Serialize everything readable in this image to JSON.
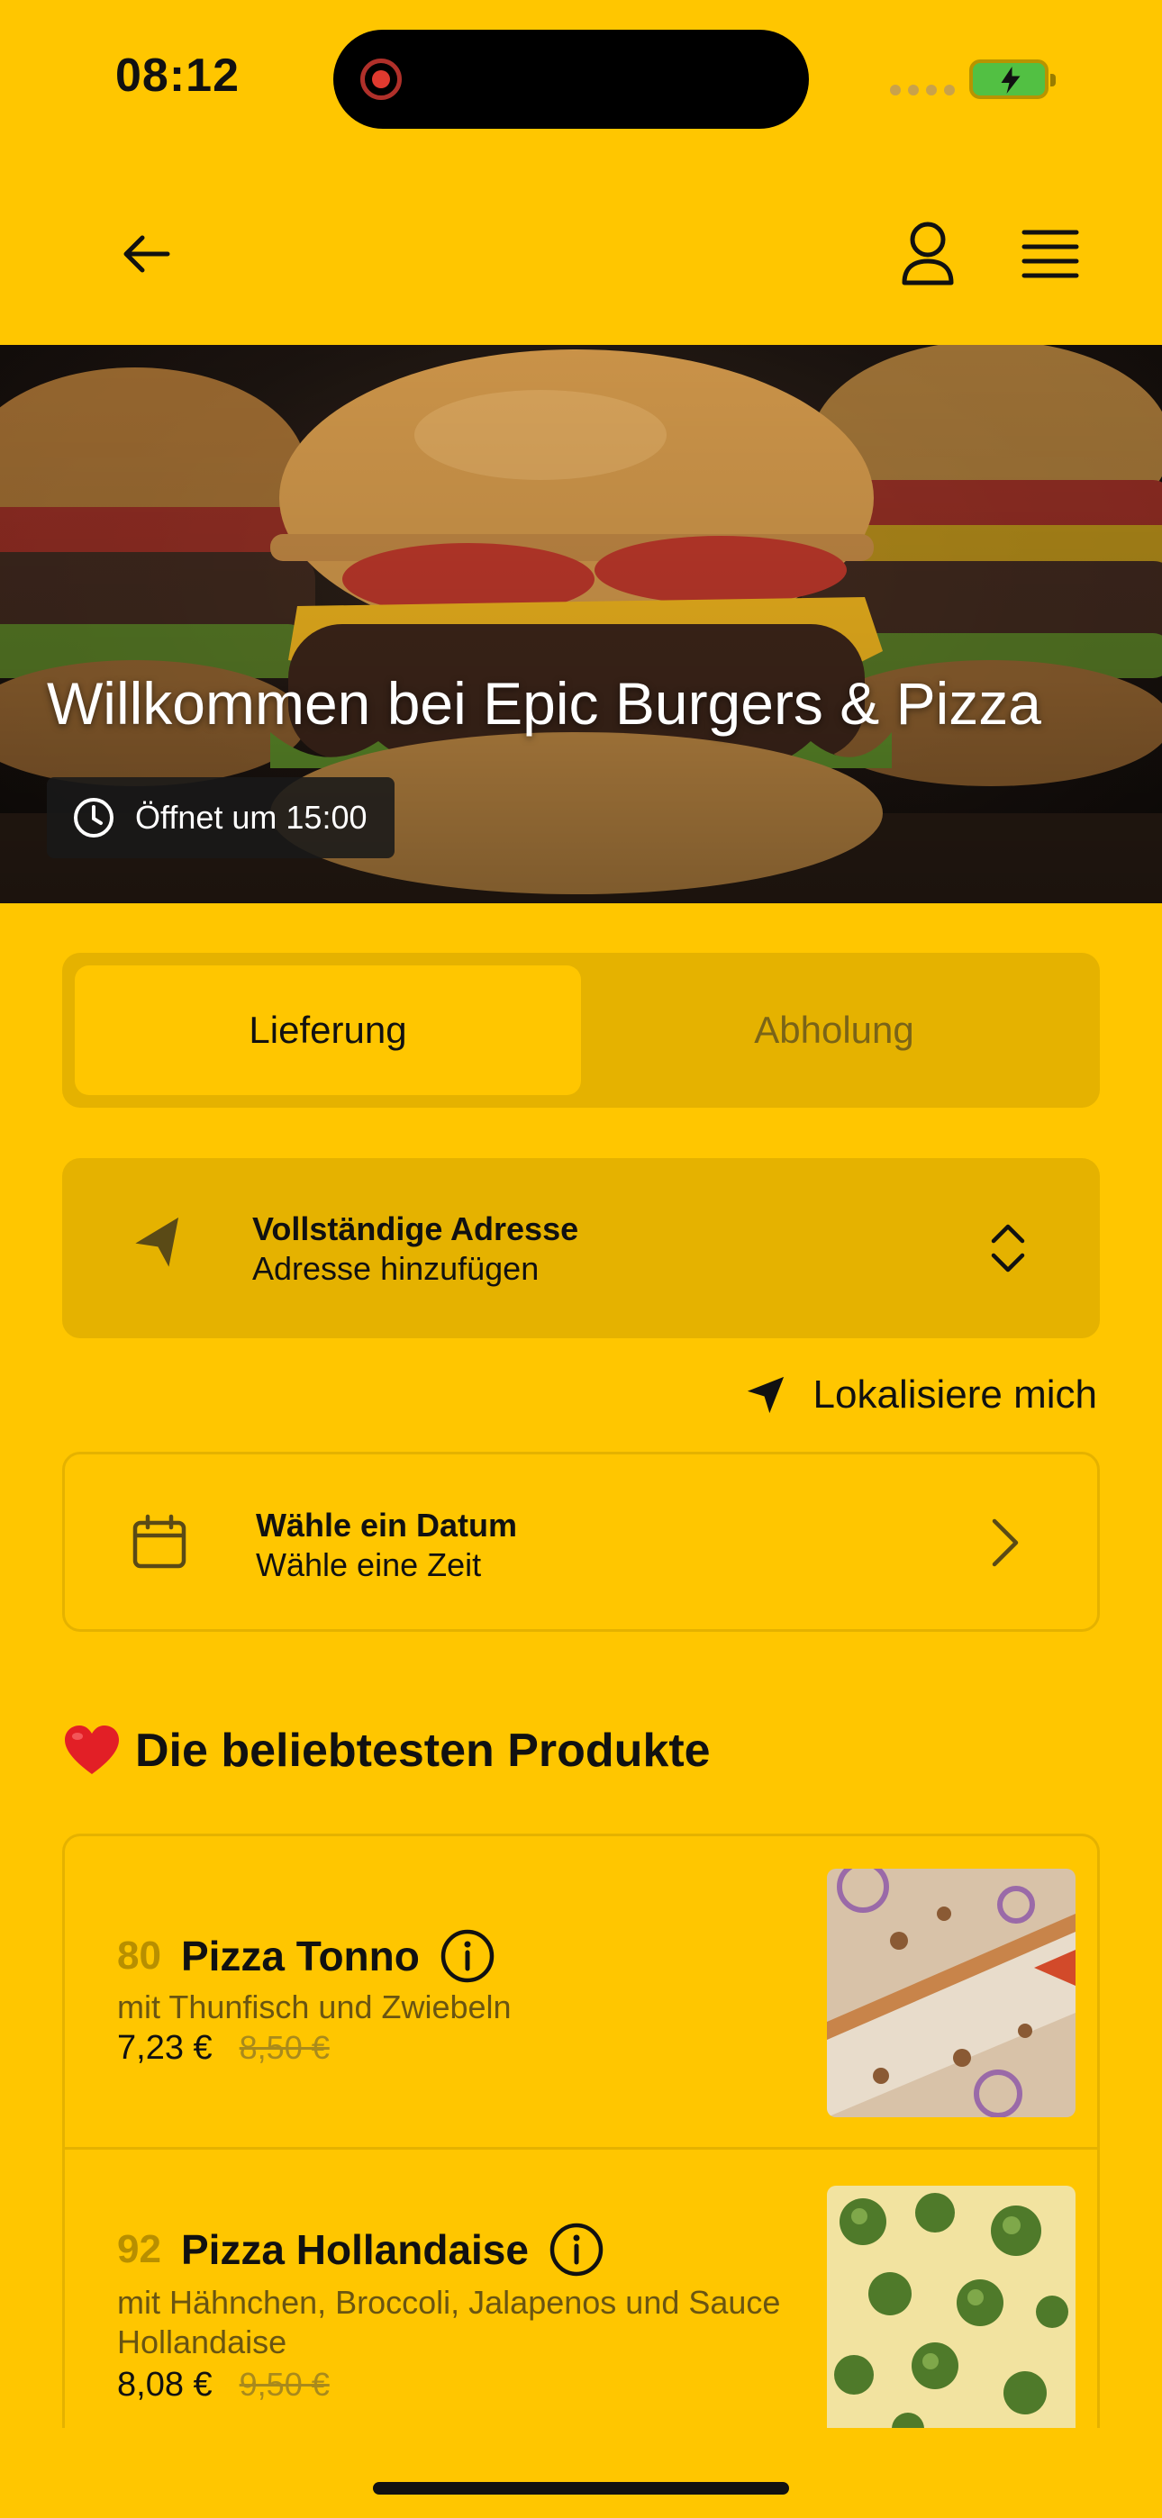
{
  "status_bar": {
    "time": "08:12"
  },
  "hero": {
    "title": "Willkommen bei Epic Burgers & Pizza",
    "opening": "Öffnet um 15:00"
  },
  "tabs": [
    {
      "label": "Lieferung",
      "active": true
    },
    {
      "label": "Abholung",
      "active": false
    }
  ],
  "address": {
    "title": "Vollständige Adresse",
    "subtitle": "Adresse hinzufügen"
  },
  "locate": {
    "label": "Lokalisiere mich"
  },
  "schedule": {
    "title": "Wähle ein Datum",
    "subtitle": "Wähle eine Zeit"
  },
  "popular": {
    "title": "Die beliebtesten Produkte",
    "items": [
      {
        "number": "80",
        "name": "Pizza Tonno",
        "description": "mit Thunfisch und Zwiebeln",
        "price": "7,23 €",
        "old_price": "8,50 €"
      },
      {
        "number": "92",
        "name": "Pizza Hollandaise",
        "description": "mit Hähnchen, Broccoli, Jalapenos und Sauce Hollandaise",
        "price": "8,08 €",
        "old_price": "9,50 €"
      }
    ]
  },
  "colors": {
    "background": "#FFC600",
    "card": "#E5B200",
    "text": "#111111"
  }
}
